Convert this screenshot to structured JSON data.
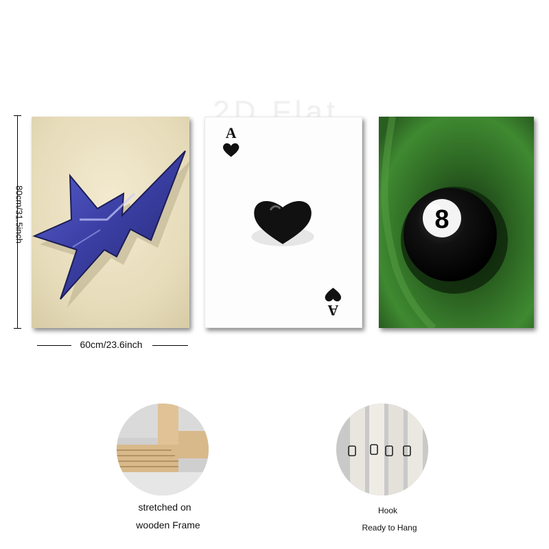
{
  "watermark": "2D Flat",
  "dimensions": {
    "height_label": "80cm/31.5inch",
    "width_label": "60cm/23.6inch"
  },
  "panels": [
    {
      "subject": "blue lightning star",
      "colors": {
        "background": "#e9dfc1",
        "star": "#3b3fa6"
      }
    },
    {
      "subject": "ace of hearts card",
      "rank": "A",
      "colors": {
        "background": "#fdfdfd",
        "heart": "#111111"
      }
    },
    {
      "subject": "eight ball",
      "ball_number": "8",
      "colors": {
        "background": "#2f6a24",
        "ball": "#0d0d0d"
      }
    }
  ],
  "features": [
    {
      "name": "frame",
      "caption_line1": "stretched on",
      "caption_line2": "wooden Frame"
    },
    {
      "name": "hook",
      "caption_line1": "Hook",
      "caption_line2": "Ready to Hang"
    }
  ]
}
